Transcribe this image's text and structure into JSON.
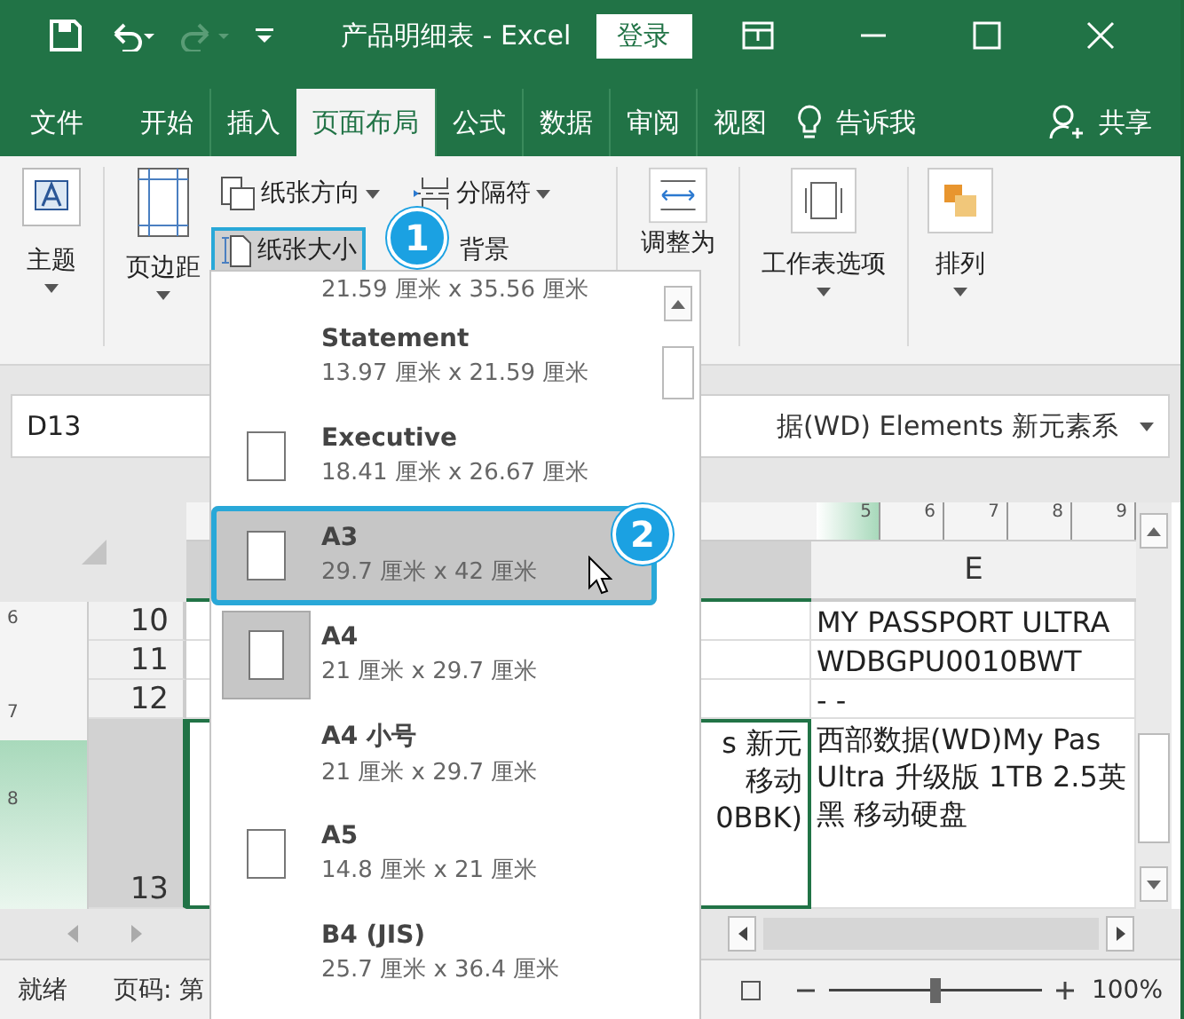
{
  "title_bar": {
    "title": "产品明细表 - Excel",
    "login": "登录"
  },
  "tabs": [
    {
      "label": "文件",
      "selected": false
    },
    {
      "label": "开始",
      "selected": false
    },
    {
      "label": "插入",
      "selected": false
    },
    {
      "label": "页面布局",
      "selected": true
    },
    {
      "label": "公式",
      "selected": false
    },
    {
      "label": "数据",
      "selected": false
    },
    {
      "label": "审阅",
      "selected": false
    },
    {
      "label": "视图",
      "selected": false
    }
  ],
  "tell_me": "告诉我",
  "share": "共享",
  "ribbon": {
    "theme": "主题",
    "margins": "页边距",
    "orientation": "纸张方向",
    "breaks": "分隔符",
    "size": "纸张大小",
    "background": "背景",
    "scale": "调整为",
    "sheet_options": "工作表选项",
    "arrange": "排列"
  },
  "name_box": "D13",
  "formula": "据(WD) Elements 新元素系",
  "ruler": [
    "5",
    "6",
    "7",
    "8",
    "9"
  ],
  "vruler": [
    "6",
    "7",
    "8"
  ],
  "columns": [
    {
      "selected": true
    },
    {
      "label": "E",
      "selected": false
    }
  ],
  "rows": [
    {
      "number": "10",
      "selected": false,
      "d": [],
      "e": [
        "MY PASSPORT ULTRA"
      ]
    },
    {
      "number": "11",
      "selected": false,
      "d": [],
      "e": [
        "WDBGPU0010BWT"
      ]
    },
    {
      "number": "12",
      "selected": false,
      "d": [],
      "e": [
        "- -"
      ]
    },
    {
      "number": "13",
      "selected": true,
      "d": [
        "s 新元",
        "移动",
        "0BBK)"
      ],
      "e": [
        "西部数据(WD)My Pas",
        "Ultra 升级版 1TB 2.5英",
        "黑 移动硬盘"
      ]
    }
  ],
  "paper_menu": {
    "items": [
      {
        "size": "21.59 厘米 x 35.56 厘米",
        "has_icon": false,
        "selected": false,
        "hovered": false
      },
      {
        "name": "Statement",
        "size": "13.97 厘米 x 21.59 厘米",
        "has_icon": false,
        "selected": false,
        "hovered": false
      },
      {
        "name": "Executive",
        "size": "18.41 厘米 x 26.67 厘米",
        "has_icon": true,
        "selected": false,
        "hovered": false
      },
      {
        "name": "A3",
        "size": "29.7 厘米 x 42 厘米",
        "has_icon": true,
        "selected": false,
        "hovered": true
      },
      {
        "name": "A4",
        "size": "21 厘米 x 29.7 厘米",
        "has_icon": true,
        "selected": true,
        "hovered": false
      },
      {
        "name": "A4 小号",
        "size": "21 厘米 x 29.7 厘米",
        "has_icon": false,
        "selected": false,
        "hovered": false
      },
      {
        "name": "A5",
        "size": "14.8 厘米 x 21 厘米",
        "has_icon": true,
        "selected": false,
        "hovered": false
      },
      {
        "name": "B4 (JIS)",
        "size": "25.7 厘米 x 36.4 厘米",
        "has_icon": false,
        "selected": false,
        "hovered": false
      }
    ]
  },
  "callouts": [
    "1",
    "2"
  ],
  "status": {
    "ready": "就绪",
    "page": "页码: 第",
    "zoom": "100%",
    "zoom_slider": {
      "level": 0.5
    }
  }
}
